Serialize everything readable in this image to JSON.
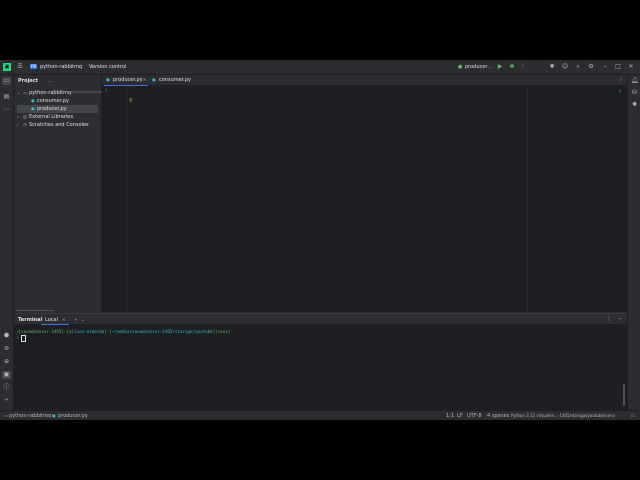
{
  "topbar": {
    "project_badge": "PR",
    "project_name": "python-rabbitmq",
    "vcs_label": "Version control",
    "run_config": "producer"
  },
  "project_panel": {
    "title": "Project",
    "tree": [
      {
        "label": "python-rabbitmq",
        "hint": "~/media/soundsensor/...",
        "type": "folder"
      },
      {
        "label": "consumer.py",
        "type": "file"
      },
      {
        "label": "producer.py",
        "type": "file",
        "selected": true
      },
      {
        "label": "External Libraries",
        "type": "lib"
      },
      {
        "label": "Scratches and Consoles",
        "type": "scratch"
      }
    ]
  },
  "editor": {
    "tabs": [
      {
        "label": "producer.py",
        "active": true
      },
      {
        "label": "consumer.py",
        "active": false
      }
    ],
    "line_numbers": [
      "1"
    ]
  },
  "terminal": {
    "tabs": [
      {
        "label": "Terminal",
        "active": true
      },
      {
        "label": "Local",
        "active": false
      }
    ],
    "prompt_host": "soundsensor-1465",
    "prompt_user": "alison-almeida",
    "prompt_path": "~/media/soundsensor-1465/storage/youtube",
    "prompt_env": "(venv)"
  },
  "statusbar": {
    "breadcrumb_project": "python-rabbitmq",
    "breadcrumb_file": "producer.py",
    "position": "1:1",
    "line_sep": "LF",
    "encoding": "UTF-8",
    "indent": "4 spaces",
    "interpreter": "Python 3.12 virtualen...-1465/storage/youtube/venv"
  },
  "colors": {
    "accent": "#3574f0",
    "run_green": "#5fb865",
    "prompt_green": "#5fb865",
    "prompt_cyan": "#3fb8c6"
  }
}
